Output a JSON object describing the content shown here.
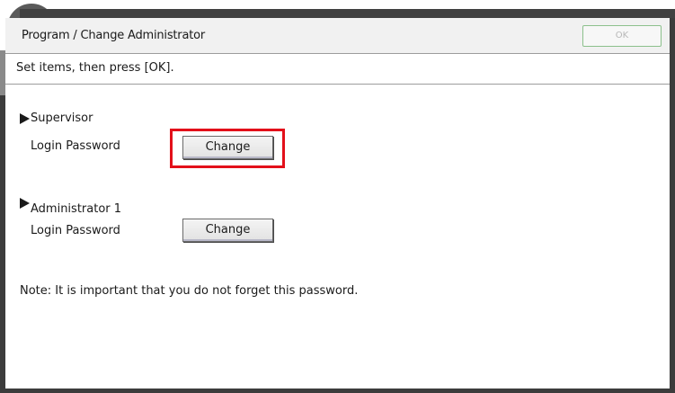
{
  "header": {
    "title": "Program / Change Administrator",
    "ok_label": "OK"
  },
  "instruction": "Set items, then press [OK].",
  "sections": [
    {
      "heading": "Supervisor",
      "row_label": "Login Password",
      "button_label": "Change"
    },
    {
      "heading": "Administrator 1",
      "row_label": "Login Password",
      "button_label": "Change"
    }
  ],
  "note": "Note: It is important that you do not forget this password.",
  "colors": {
    "highlight": "#e3101a",
    "ok_border": "#8cc08c"
  }
}
